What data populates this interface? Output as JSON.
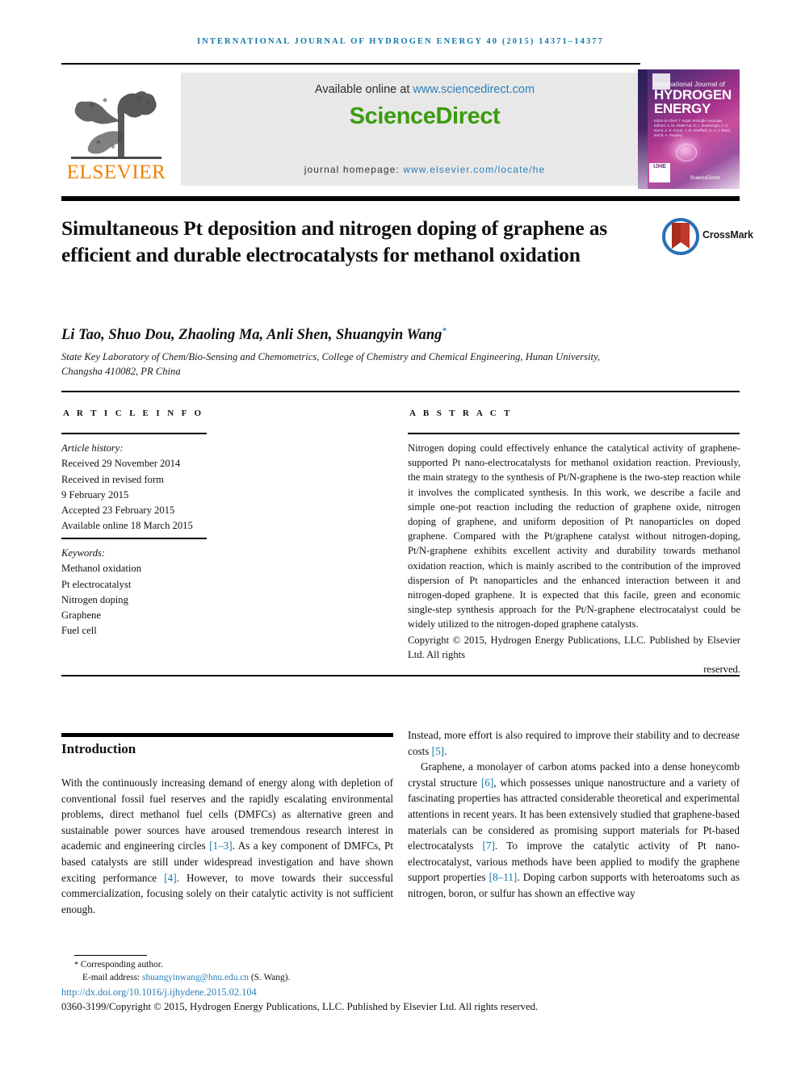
{
  "running_head": "International Journal of Hydrogen Energy 40 (2015) 14371–14377",
  "masthead": {
    "elsevier_wordmark": "ELSEVIER",
    "available_prefix": "Available online at ",
    "available_url": "www.sciencedirect.com",
    "sciencedirect_logo": "ScienceDirect",
    "homepage_prefix": "journal homepage: ",
    "homepage_url": "www.elsevier.com/locate/he",
    "cover": {
      "line1": "International Journal of",
      "line2": "HYDROGEN",
      "line3": "ENERGY",
      "editors": "Editor-in-Chief: T. Nejat Veziroğlu   Associate Editors: A. M. Abdel-Aal, D. L. Damberger, A. A. Evers, A. E. Ezzat, J. W. Sheffield, D. A. J. Rand, and B. A. Peppley",
      "badge": "IJHE",
      "publisher": "ScienceDirect"
    }
  },
  "colors": {
    "running_head": "#1278a8",
    "link": "#2a7fb8",
    "sciencedirect_green": "#3a9c0f",
    "elsevier_orange": "#f08000",
    "cover_purple": "#a8338c",
    "crossmark_blue": "#2a6fb8",
    "crossmark_red": "#c0392b"
  },
  "article": {
    "title": "Simultaneous Pt deposition and nitrogen doping of graphene as efficient and durable electrocatalysts for methanol oxidation",
    "crossmark_label": "CrossMark",
    "authors": "Li Tao, Shuo Dou, Zhaoling Ma, Anli Shen, Shuangyin Wang",
    "author_marker": "*",
    "affiliation": "State Key Laboratory of Chem/Bio-Sensing and Chemometrics, College of Chemistry and Chemical Engineering, Hunan University, Changsha 410082, PR China"
  },
  "sections": {
    "article_info_heading": "A R T I C L E   I N F O",
    "abstract_heading": "A B S T R A C T",
    "introduction_heading": "Introduction"
  },
  "article_info": {
    "history_label": "Article history:",
    "history": [
      "Received 29 November 2014",
      "Received in revised form",
      "9 February 2015",
      "Accepted 23 February 2015",
      "Available online 18 March 2015"
    ],
    "keywords_label": "Keywords:",
    "keywords": [
      "Methanol oxidation",
      "Pt electrocatalyst",
      "Nitrogen doping",
      "Graphene",
      "Fuel cell"
    ]
  },
  "abstract": {
    "body": "Nitrogen doping could effectively enhance the catalytical activity of graphene-supported Pt nano-electrocatalysts for methanol oxidation reaction. Previously, the main strategy to the synthesis of Pt/N-graphene is the two-step reaction while it involves the complicated synthesis. In this work, we describe a facile and simple one-pot reaction including the reduction of graphene oxide, nitrogen doping of graphene, and uniform deposition of Pt nanoparticles on doped graphene. Compared with the Pt/graphene catalyst without nitrogen-doping, Pt/N-graphene exhibits excellent activity and durability towards methanol oxidation reaction, which is mainly ascribed to the contribution of the improved dispersion of Pt nanoparticles and the enhanced interaction between it and nitrogen-doped graphene. It is expected that this facile, green and economic single-step synthesis approach for the Pt/N-graphene electrocatalyst could be widely utilized to the nitrogen-doped graphene catalysts.",
    "copyright_main": "Copyright © 2015, Hydrogen Energy Publications, LLC. Published by Elsevier Ltd. All rights",
    "copyright_tail": "reserved."
  },
  "body": {
    "left_paragraph": "With the continuously increasing demand of energy along with depletion of conventional fossil fuel reserves and the rapidly escalating environmental problems, direct methanol fuel cells (DMFCs) as alternative green and sustainable power sources have aroused tremendous research interest in academic and engineering circles ",
    "left_ref_1": "[1–3]",
    "left_part_2": ". As a key component of DMFCs, Pt based catalysts are still under widespread investigation and have shown exciting performance ",
    "left_ref_2": "[4]",
    "left_part_3": ". However, to move towards their successful commercialization, focusing solely on their catalytic activity is not sufficient enough.",
    "right_part_1": "Instead, more effort is also required to improve their stability and to decrease costs ",
    "right_ref_1": "[5]",
    "right_part_2": ".",
    "right_part_3": "Graphene, a monolayer of carbon atoms packed into a dense honeycomb crystal structure ",
    "right_ref_2": "[6]",
    "right_part_4": ", which possesses unique nanostructure and a variety of fascinating properties has attracted considerable theoretical and experimental attentions in recent years. It has been extensively studied that graphene-based materials can be considered as promising support materials for Pt-based electrocatalysts ",
    "right_ref_3": "[7]",
    "right_part_5": ". To improve the catalytic activity of Pt nano-electrocatalyst, various methods have been applied to modify the graphene support properties ",
    "right_ref_4": "[8–11]",
    "right_part_6": ". Doping carbon supports with heteroatoms such as nitrogen, boron, or sulfur has shown an effective way"
  },
  "footer": {
    "corresponding_marker": "*",
    "corresponding_label": " Corresponding author.",
    "email_label": "E-mail address: ",
    "email": "shuangyinwang@hnu.edu.cn",
    "email_suffix": " (S. Wang).",
    "doi": "http://dx.doi.org/10.1016/j.ijhydene.2015.02.104",
    "issn_line": "0360-3199/Copyright © 2015, Hydrogen Energy Publications, LLC. Published by Elsevier Ltd. All rights reserved."
  }
}
